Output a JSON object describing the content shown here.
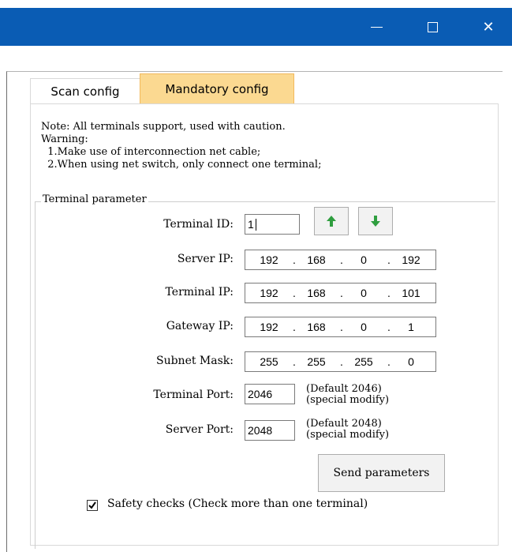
{
  "titlebar": {
    "minimize_icon": "minimize-icon",
    "maximize_icon": "maximize-icon",
    "close_icon": "close-icon",
    "close_glyph": "✕",
    "color": "#0a5cb4"
  },
  "tabs": [
    {
      "label": "Scan config",
      "active": false
    },
    {
      "label": "Mandatory config",
      "active": true,
      "color": "#fbd991"
    }
  ],
  "notes": {
    "line1": "Note: All terminals support, used with caution.",
    "line2": "Warning:",
    "line3": "  1.Make use of interconnection net cable;",
    "line4": "  2.When using net switch, only connect one terminal;"
  },
  "group": {
    "title": "Terminal parameter",
    "terminal_id_label": "Terminal ID:",
    "terminal_id_value": "1",
    "up_icon": "arrow-up-icon",
    "down_icon": "arrow-down-icon",
    "arrow_color": "#2f9e3f",
    "server_ip_label": "Server IP:",
    "server_ip": [
      "192",
      "168",
      "0",
      "192"
    ],
    "terminal_ip_label": "Terminal IP:",
    "terminal_ip": [
      "192",
      "168",
      "0",
      "101"
    ],
    "gateway_ip_label": "Gateway IP:",
    "gateway_ip": [
      "192",
      "168",
      "0",
      "1"
    ],
    "subnet_mask_label": "Subnet Mask:",
    "subnet_mask": [
      "255",
      "255",
      "255",
      "0"
    ],
    "dot": ".",
    "terminal_port_label": "Terminal Port:",
    "terminal_port_value": "2046",
    "terminal_port_hint1": "(Default 2046)",
    "terminal_port_hint2": "(special modify)",
    "server_port_label": "Server Port:",
    "server_port_value": "2048",
    "server_port_hint1": "(Default 2048)",
    "server_port_hint2": "(special modify)",
    "send_label": "Send parameters",
    "safety_checked": true,
    "safety_label": "Safety checks (Check more than one terminal)"
  }
}
